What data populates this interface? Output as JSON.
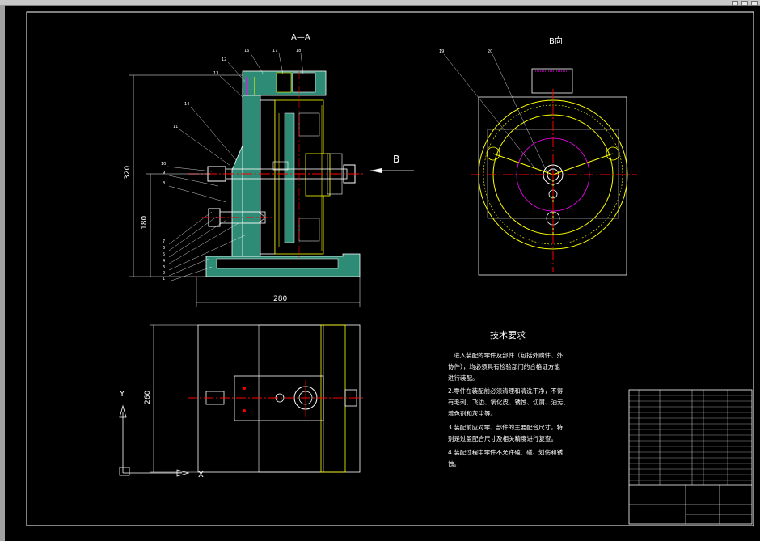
{
  "window": {
    "controls": [
      "minimize",
      "maximize",
      "close"
    ]
  },
  "section_view": {
    "title": "A—A"
  },
  "b_view": {
    "title": "B向"
  },
  "arrow_b": {
    "label": "B"
  },
  "dimensions": {
    "height_total": "320",
    "height_center": "180",
    "width_base": "280",
    "width_plan": "260"
  },
  "part_numbers": {
    "top": [
      "12",
      "16",
      "17",
      "18"
    ],
    "left": [
      "13",
      "14",
      "11",
      "10",
      "9",
      "8",
      "7",
      "6",
      "5",
      "4",
      "3",
      "2",
      "1"
    ],
    "b_view": [
      "19",
      "20"
    ]
  },
  "ucs": {
    "y_label": "Y",
    "x_label": "X"
  },
  "tech_requirements": {
    "heading": "技术要求",
    "items": [
      "1.进入装配的零件及部件（包括外购件、外",
      "协件），均必须具有检验部门的合格证方能",
      "进行装配。",
      "2.零件在装配前必须清理和清洗干净，不得",
      "有毛刺、飞边、氧化皮、锈蚀、切屑、油污、",
      "着色剂和灰尘等。",
      "3.装配前应对零、部件的主要配合尺寸，特",
      "别是过盈配合尺寸及相关精度进行复查。",
      "4.装配过程中零件不允许磕、碰、划伤和锈",
      "蚀。"
    ]
  },
  "colors": {
    "background": "#000000",
    "border": "#ffffff",
    "green_fill": "#2e8b75",
    "yellow": "#ffff00",
    "red": "#ff0000",
    "magenta": "#ff00ff",
    "cyan": "#00ffff"
  }
}
